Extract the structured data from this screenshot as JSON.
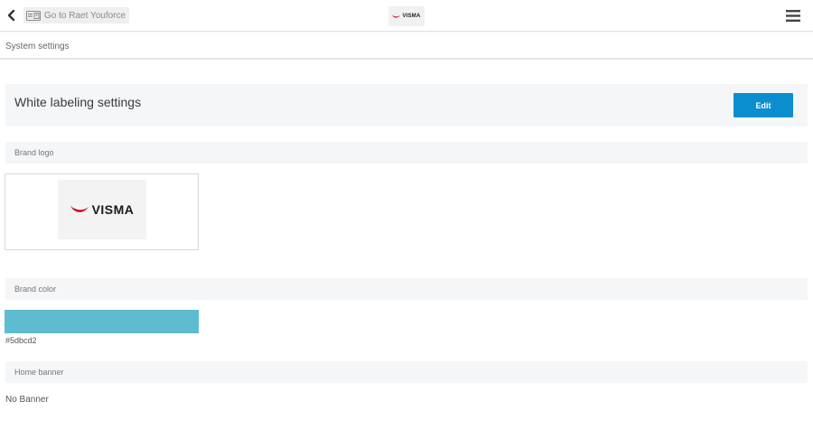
{
  "topbar": {
    "back_icon": "chevron-left-icon",
    "goto_label": "Go to Raet Youforce",
    "goto_icon": "id-card-icon",
    "brand_word": "VISMA",
    "menu_icon": "hamburger-menu-icon"
  },
  "breadcrumb": "System settings",
  "section": {
    "title": "White labeling settings",
    "edit_label": "Edit"
  },
  "brand_logo": {
    "label": "Brand logo",
    "word": "VISMA"
  },
  "brand_color": {
    "label": "Brand color",
    "hex": "#5dbcd2"
  },
  "home_banner": {
    "label": "Home banner",
    "value": "No Banner"
  },
  "colors": {
    "accent": "#0b8ecf",
    "brand_color": "#5dbcd2",
    "visma_red": "#c8102e"
  }
}
